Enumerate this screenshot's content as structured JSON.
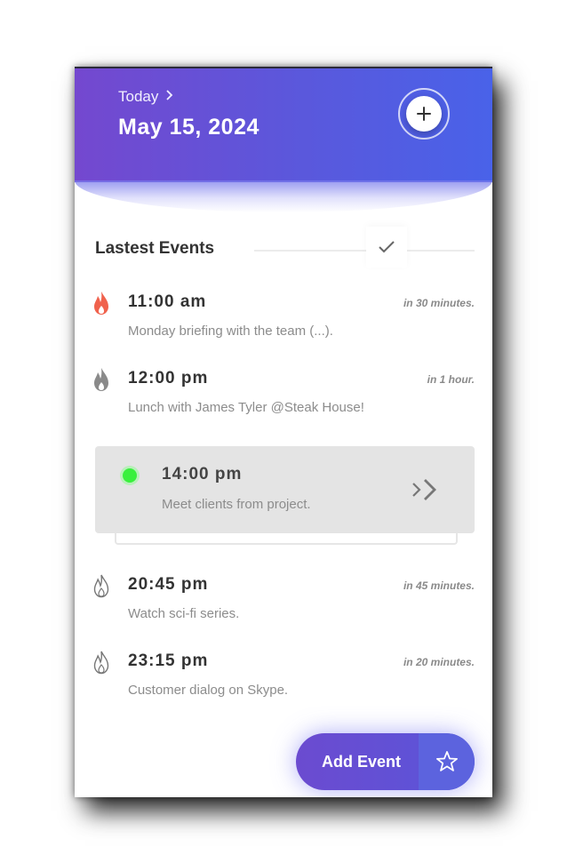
{
  "header": {
    "today_label": "Today",
    "date": "May 15, 2024",
    "gradient_start": "#7448cf",
    "gradient_end": "#4962e9"
  },
  "section": {
    "title": "Lastest Events"
  },
  "events": [
    {
      "time": "11:00 am",
      "relative": "in 30 minutes.",
      "description": "Monday briefing with the team (...).",
      "icon": "flame-filled-red-icon"
    },
    {
      "time": "12:00 pm",
      "relative": "in 1 hour.",
      "description": "Lunch with James Tyler @Steak House!",
      "icon": "flame-filled-gray-icon"
    },
    {
      "time": "14:00 pm",
      "description": "Meet clients from project.",
      "icon": "status-dot-green-icon",
      "active": true
    },
    {
      "time": "20:45 pm",
      "relative": "in 45 minutes.",
      "description": "Watch sci-fi series.",
      "icon": "flame-outline-icon"
    },
    {
      "time": "23:15 pm",
      "relative": "in 20 minutes.",
      "description": "Customer dialog on Skype.",
      "icon": "flame-outline-icon"
    }
  ],
  "fab": {
    "label": "Add Event",
    "icon": "star-outline-icon"
  },
  "colors": {
    "accent_red": "#f0624d",
    "active_green": "#39f03d",
    "fab": "#6b4bd0"
  }
}
